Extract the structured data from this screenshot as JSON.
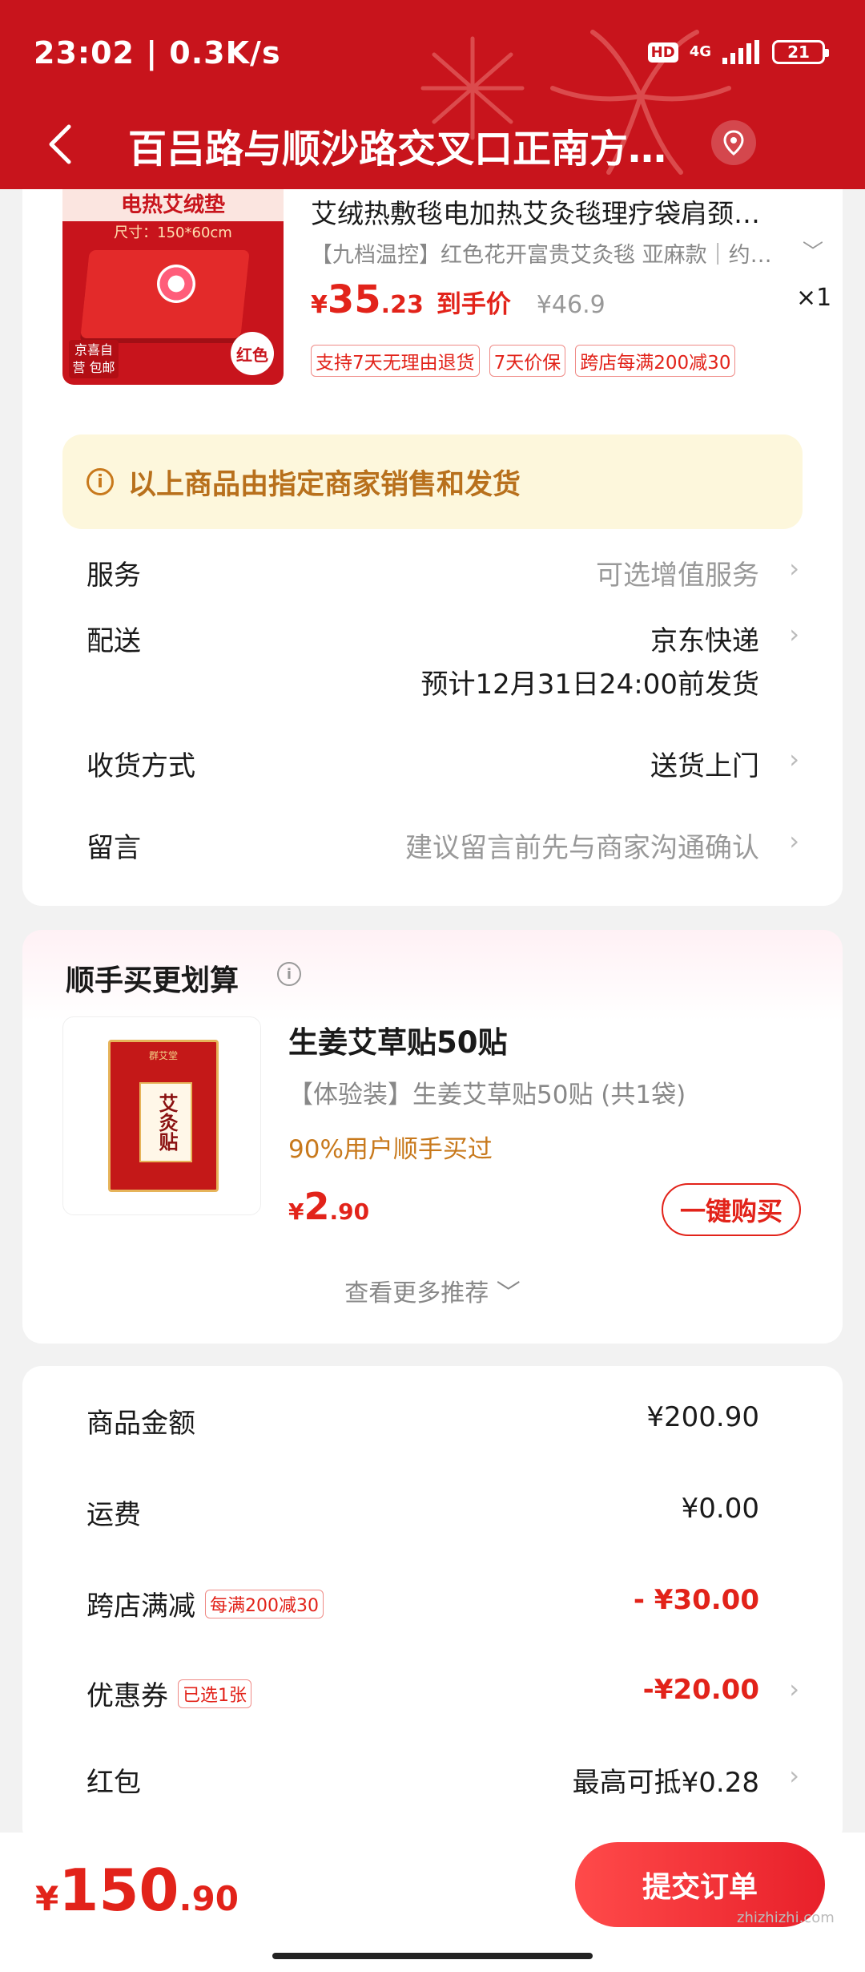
{
  "status_bar": {
    "time": "23:02 | 0.3K/s",
    "hd": "HD",
    "network": "4G",
    "battery": "21"
  },
  "nav": {
    "title": "百吕路与顺沙路交叉口正南方…"
  },
  "product": {
    "thumb_title": "电热艾绒垫",
    "thumb_size": "尺寸：150*60cm",
    "thumb_tag": "京喜自营 包邮",
    "thumb_color": "红色",
    "name": "艾绒热敷毯电加热艾灸毯理疗袋肩颈…",
    "spec": "【九档温控】红色花开富贵艾灸毯 亚麻款｜约…",
    "price_symbol": "¥",
    "price_int": "35",
    "price_dec": ".23",
    "price_note": "到手价",
    "orig_price": "¥46.9",
    "qty": "×1",
    "tags": [
      "支持7天无理由退货",
      "7天价保",
      "跨店每满200减30"
    ]
  },
  "notice": {
    "icon": "i",
    "text": "以上商品由指定商家销售和发货"
  },
  "rows": {
    "service_label": "服务",
    "service_value": "可选增值服务",
    "delivery_label": "配送",
    "delivery_value": "京东快递",
    "delivery_sub": "预计12月31日24:00前发货",
    "receive_label": "收货方式",
    "receive_value": "送货上门",
    "message_label": "留言",
    "message_value": "建议留言前先与商家沟通确认"
  },
  "upsell": {
    "title": "顺手买更划算",
    "pack_brand": "群艾堂",
    "pack_name": "艾灸贴",
    "name": "生姜艾草贴50贴",
    "spec": "【体验装】生姜艾草贴50贴 (共1袋)",
    "buyers": "90%用户顺手买过",
    "price_symbol": "¥",
    "price_int": "2",
    "price_dec": ".90",
    "buy_label": "一键购买",
    "more_label": "查看更多推荐 ﹀"
  },
  "summary": {
    "goods_label": "商品金额",
    "goods_value": "¥200.90",
    "freight_label": "运费",
    "freight_value": "¥0.00",
    "cross_label": "跨店满减",
    "cross_badge": "每满200减30",
    "cross_value": "- ¥30.00",
    "coupon_label": "优惠券",
    "coupon_badge": "已选1张",
    "coupon_value": "-¥20.00",
    "redpack_label": "红包",
    "redpack_value": "最高可抵¥0.28"
  },
  "bottom": {
    "total_symbol": "¥",
    "total_int": "150",
    "total_dec": ".90",
    "submit_label": "提交订单",
    "watermark": "zhizhizhi.com"
  },
  "colors": {
    "header_red": "#c8141c",
    "price_red": "#e2231a",
    "notice_bg": "#fdf7dc",
    "notice_text": "#b8701c"
  }
}
